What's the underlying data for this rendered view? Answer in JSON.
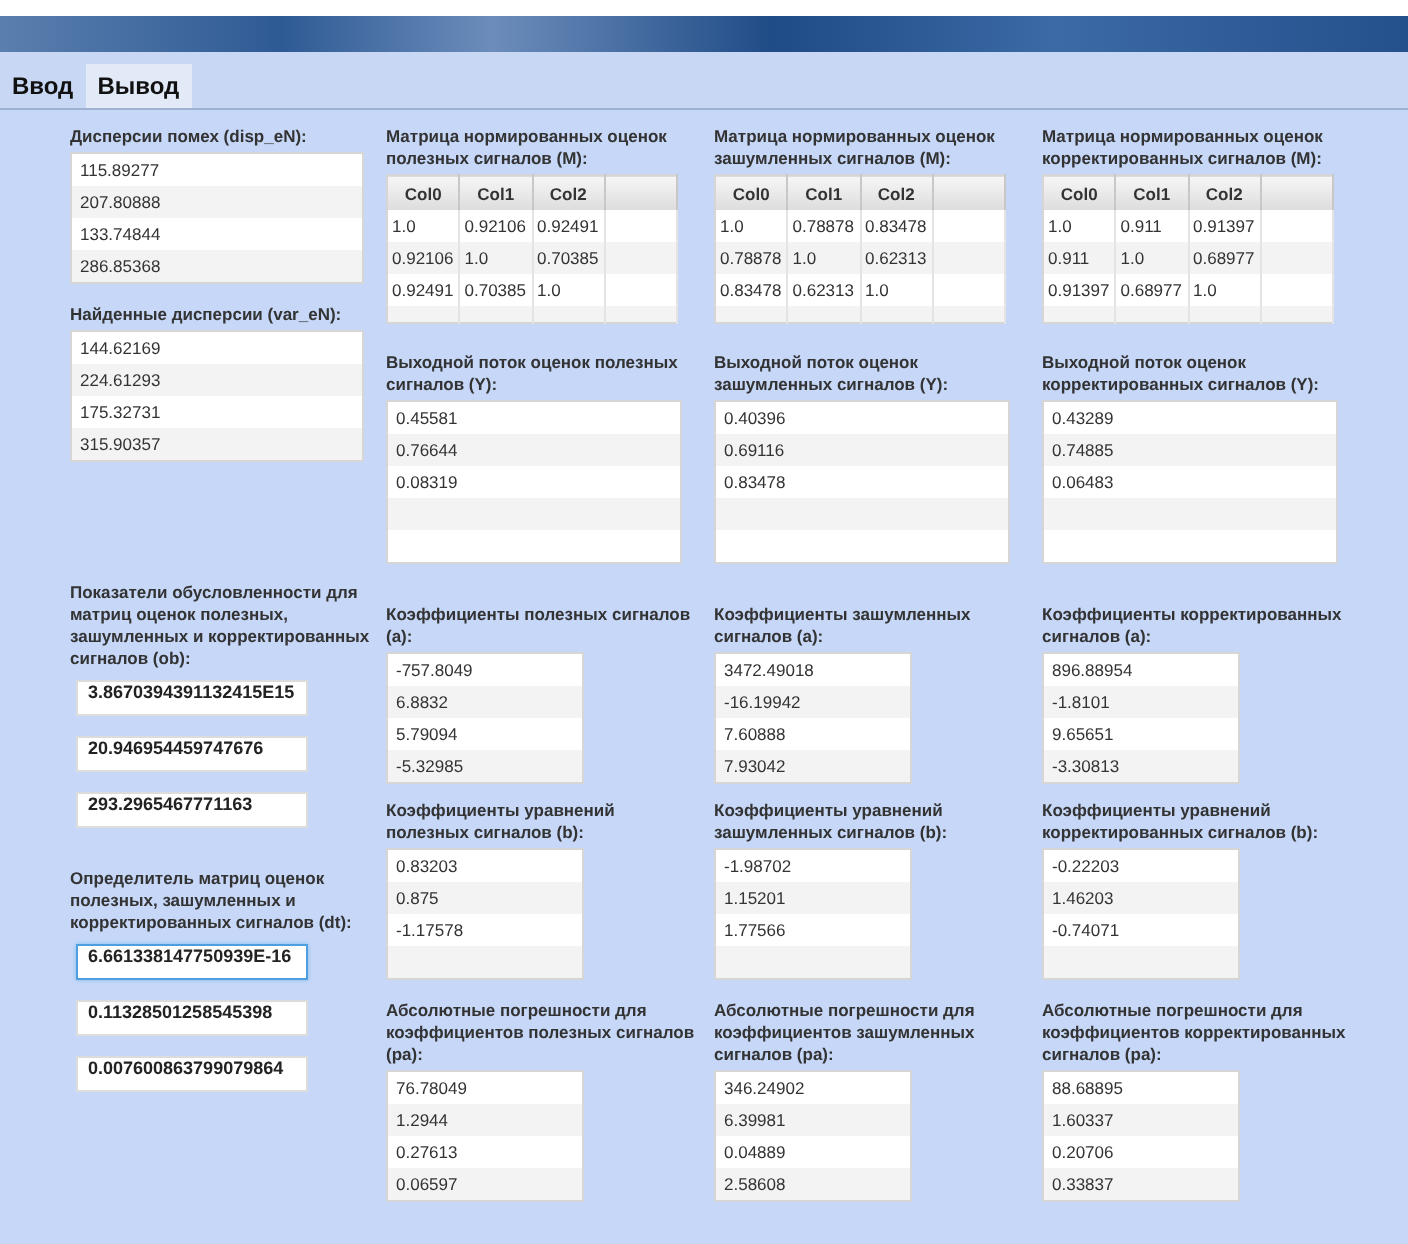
{
  "tabs": [
    {
      "label": "Ввод",
      "selected": false
    },
    {
      "label": "Вывод",
      "selected": true
    }
  ],
  "left": [
    {
      "kind": "list",
      "title": "Дисперсии помех (disp_eN):",
      "values": [
        "115.89277",
        "207.80888",
        "133.74844",
        "286.85368"
      ]
    },
    {
      "kind": "list",
      "title": "Найденные дисперсии (var_eN):",
      "values": [
        "144.62169",
        "224.61293",
        "175.32731",
        "315.90357"
      ]
    },
    {
      "kind": "fields",
      "title": "Показатели обусловленности для матриц оценок полезных, зашумленных и корректированных сигналов (ob):",
      "fields": [
        {
          "value": "3.8670394391132415E15",
          "focused": false
        },
        {
          "value": "20.946954459747676",
          "focused": false
        },
        {
          "value": "293.2965467771163",
          "focused": false
        }
      ]
    },
    {
      "kind": "fields",
      "title": "Определитель матриц оценок полезных, зашумленных и корректированных сигналов (dt):",
      "fields": [
        {
          "value": "6.661338147750939E-16",
          "focused": true
        },
        {
          "value": "0.11328501258545398",
          "focused": false
        },
        {
          "value": "0.007600863799079864",
          "focused": false
        }
      ]
    }
  ],
  "sections": [
    {
      "kind": "matrix",
      "items": [
        {
          "title": "Матрица нормированных оценок полезных сигналов (M):",
          "columns": [
            "Col0",
            "Col1",
            "Col2"
          ],
          "rows": [
            [
              "1.0",
              "0.92106",
              "0.92491"
            ],
            [
              "0.92106",
              "1.0",
              "0.70385"
            ],
            [
              "0.92491",
              "0.70385",
              "1.0"
            ]
          ]
        },
        {
          "title": "Матрица нормированных оценок зашумленных сигналов (M):",
          "columns": [
            "Col0",
            "Col1",
            "Col2"
          ],
          "rows": [
            [
              "1.0",
              "0.78878",
              "0.83478"
            ],
            [
              "0.78878",
              "1.0",
              "0.62313"
            ],
            [
              "0.83478",
              "0.62313",
              "1.0"
            ]
          ]
        },
        {
          "title": "Матрица нормированных оценок корректированных сигналов (M):",
          "columns": [
            "Col0",
            "Col1",
            "Col2"
          ],
          "rows": [
            [
              "1.0",
              "0.911",
              "0.91397"
            ],
            [
              "0.911",
              "1.0",
              "0.68977"
            ],
            [
              "0.91397",
              "0.68977",
              "1.0"
            ]
          ]
        }
      ]
    },
    {
      "kind": "output",
      "items": [
        {
          "title": "Выходной поток оценок полезных сигналов (Y):",
          "values": [
            "0.45581",
            "0.76644",
            "0.08319"
          ]
        },
        {
          "title": "Выходной поток оценок зашумленных сигналов (Y):",
          "values": [
            "0.40396",
            "0.69116",
            "0.83478"
          ]
        },
        {
          "title": "Выходной поток оценок корректированных сигналов (Y):",
          "values": [
            "0.43289",
            "0.74885",
            "0.06483"
          ]
        }
      ]
    },
    {
      "kind": "coef",
      "items": [
        {
          "title": "Коэффициенты полезных сигналов (a):",
          "values": [
            "-757.8049",
            "6.8832",
            "5.79094",
            "-5.32985"
          ]
        },
        {
          "title": "Коэффициенты зашумленных сигналов (a):",
          "values": [
            "3472.49018",
            "-16.19942",
            "7.60888",
            "7.93042"
          ]
        },
        {
          "title": "Коэффициенты корректированных сигналов (a):",
          "values": [
            "896.88954",
            "-1.8101",
            "9.65651",
            "-3.30813"
          ]
        }
      ]
    },
    {
      "kind": "coef",
      "items": [
        {
          "title": "Коэффициенты уравнений полезных сигналов (b):",
          "values": [
            "0.83203",
            "0.875",
            "-1.17578"
          ]
        },
        {
          "title": "Коэффициенты уравнений зашумленных сигналов (b):",
          "values": [
            "-1.98702",
            "1.15201",
            "1.77566"
          ]
        },
        {
          "title": "Коэффициенты уравнений корректированных сигналов (b):",
          "values": [
            "-0.22203",
            "1.46203",
            "-0.74071"
          ]
        }
      ]
    },
    {
      "kind": "coef",
      "items": [
        {
          "title": "Абсолютные погрешности для коэффициентов полезных сигналов (pa):",
          "values": [
            "76.78049",
            "1.2944",
            "0.27613",
            "0.06597"
          ]
        },
        {
          "title": "Абсолютные погрешности для коэффициентов зашумленных сигналов (pa):",
          "values": [
            "346.24902",
            "6.39981",
            "0.04889",
            "2.58608"
          ]
        },
        {
          "title": "Абсолютные погрешности для коэффициентов корректированных сигналов (pa):",
          "values": [
            "88.68895",
            "1.60337",
            "0.20706",
            "0.33837"
          ]
        }
      ]
    }
  ]
}
